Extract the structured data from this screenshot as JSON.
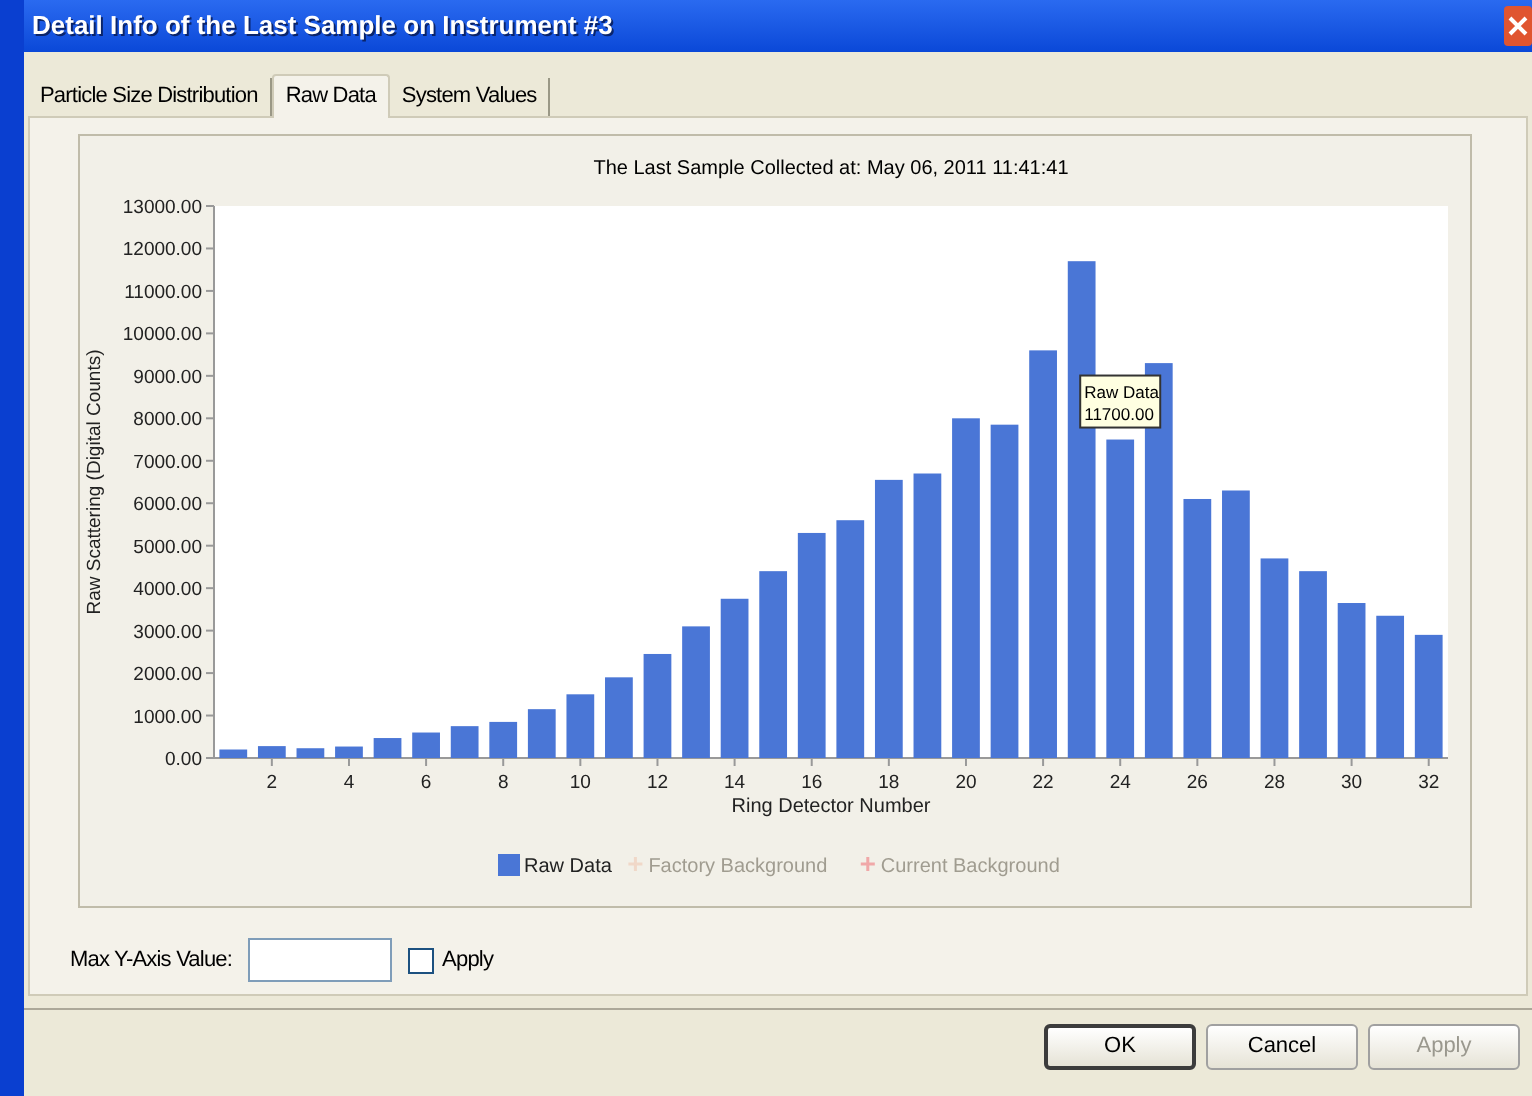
{
  "window": {
    "title": "Detail Info of the Last Sample on Instrument #3"
  },
  "tabs": [
    {
      "label": "Particle Size Distribution",
      "selected": false
    },
    {
      "label": "Raw Data",
      "selected": true
    },
    {
      "label": "System Values",
      "selected": false
    }
  ],
  "chart": {
    "chart_data": {
      "type": "bar",
      "title": "The Last Sample Collected at: May 06, 2011  11:41:41",
      "xlabel": "Ring Detector Number",
      "ylabel": "Raw Scattering (Digital Counts)",
      "x": [
        1,
        2,
        3,
        4,
        5,
        6,
        7,
        8,
        9,
        10,
        11,
        12,
        13,
        14,
        15,
        16,
        17,
        18,
        19,
        20,
        21,
        22,
        23,
        24,
        25,
        26,
        27,
        28,
        29,
        30,
        31,
        32
      ],
      "series": [
        {
          "name": "Raw Data",
          "color": "#4a76d6",
          "values": [
            200,
            280,
            230,
            270,
            470,
            600,
            750,
            850,
            1150,
            1500,
            1900,
            2450,
            3100,
            3750,
            4400,
            5300,
            5600,
            6550,
            6700,
            8000,
            7850,
            9600,
            11700,
            7500,
            9300,
            6100,
            6300,
            4700,
            4400,
            3650,
            3350,
            2900
          ]
        }
      ],
      "xlim": [
        0.5,
        32.5
      ],
      "ylim": [
        0,
        13000
      ],
      "xticks": [
        {
          "value": 2,
          "label": "2"
        },
        {
          "value": 4,
          "label": "4"
        },
        {
          "value": 6,
          "label": "6"
        },
        {
          "value": 8,
          "label": "8"
        },
        {
          "value": 10,
          "label": "10"
        },
        {
          "value": 12,
          "label": "12"
        },
        {
          "value": 14,
          "label": "14"
        },
        {
          "value": 16,
          "label": "16"
        },
        {
          "value": 18,
          "label": "18"
        },
        {
          "value": 20,
          "label": "20"
        },
        {
          "value": 22,
          "label": "22"
        },
        {
          "value": 24,
          "label": "24"
        },
        {
          "value": 26,
          "label": "26"
        },
        {
          "value": 28,
          "label": "28"
        },
        {
          "value": 30,
          "label": "30"
        },
        {
          "value": 32,
          "label": "32"
        }
      ],
      "yticks": [
        {
          "value": 0,
          "label": "0.00"
        },
        {
          "value": 1000,
          "label": "1000.00"
        },
        {
          "value": 2000,
          "label": "2000.00"
        },
        {
          "value": 3000,
          "label": "3000.00"
        },
        {
          "value": 4000,
          "label": "4000.00"
        },
        {
          "value": 5000,
          "label": "5000.00"
        },
        {
          "value": 6000,
          "label": "6000.00"
        },
        {
          "value": 7000,
          "label": "7000.00"
        },
        {
          "value": 8000,
          "label": "8000.00"
        },
        {
          "value": 9000,
          "label": "9000.00"
        },
        {
          "value": 10000,
          "label": "10000.00"
        },
        {
          "value": 11000,
          "label": "11000.00"
        },
        {
          "value": 12000,
          "label": "12000.00"
        },
        {
          "value": 13000,
          "label": "13000.00"
        }
      ]
    },
    "tooltip": {
      "lines": [
        "Raw Data",
        "11700.00"
      ]
    },
    "legend": [
      {
        "kind": "square",
        "disabled": false
      },
      {
        "label": "Factory Background",
        "kind": "cross",
        "color": "#f0d8c8",
        "disabled": true
      },
      {
        "label": "Current Background",
        "kind": "cross",
        "color": "#f0a8a8",
        "disabled": true
      }
    ]
  },
  "max_y": {
    "label": "Max Y-Axis Value:",
    "apply": {
      "label": "Apply",
      "checked": false
    }
  },
  "buttons": [
    {
      "label": "OK",
      "disabled": false,
      "default": true
    },
    {
      "label": "Cancel",
      "disabled": false,
      "default": false
    },
    {
      "label": "Apply",
      "disabled": true,
      "default": false
    }
  ]
}
